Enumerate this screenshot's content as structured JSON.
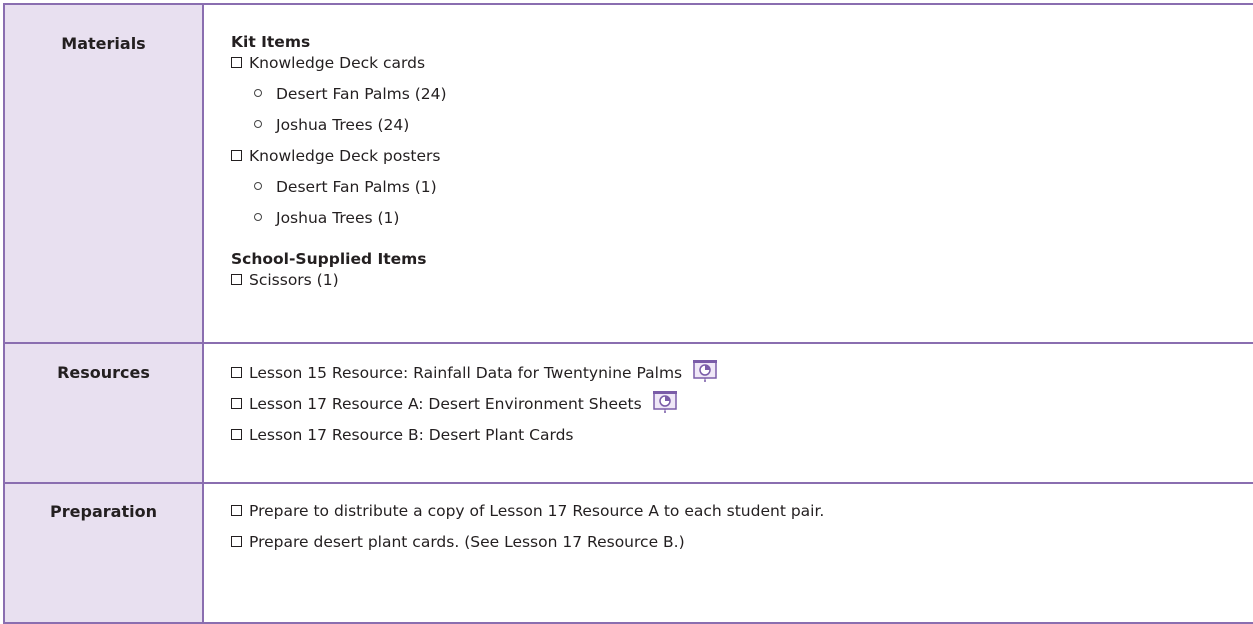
{
  "materials": {
    "label": "Materials",
    "kit_heading": "Kit Items",
    "kit_items": [
      {
        "text": "Knowledge Deck cards",
        "subitems": [
          "Desert Fan Palms (24)",
          "Joshua Trees (24)"
        ]
      },
      {
        "text": "Knowledge Deck posters",
        "subitems": [
          "Desert Fan Palms (1)",
          "Joshua Trees (1)"
        ]
      }
    ],
    "school_heading": "School-Supplied Items",
    "school_items": [
      "Scissors (1)"
    ]
  },
  "resources": {
    "label": "Resources",
    "items": [
      {
        "text": "Lesson 15 Resource: Rainfall Data for Twentynine Palms",
        "icon": "projector-icon"
      },
      {
        "text": "Lesson 17 Resource A: Desert Environment Sheets",
        "icon": "projector-icon"
      },
      {
        "text": "Lesson 17 Resource B: Desert Plant Cards"
      }
    ]
  },
  "preparation": {
    "label": "Preparation",
    "items": [
      "Prepare to distribute a copy of Lesson 17 Resource A to each student pair.",
      "Prepare desert plant cards. (See Lesson 17 Resource B.)"
    ]
  },
  "colors": {
    "border": "#8a6eb0",
    "label_bg": "#e8e0f0",
    "icon": "#7a5ca8"
  }
}
